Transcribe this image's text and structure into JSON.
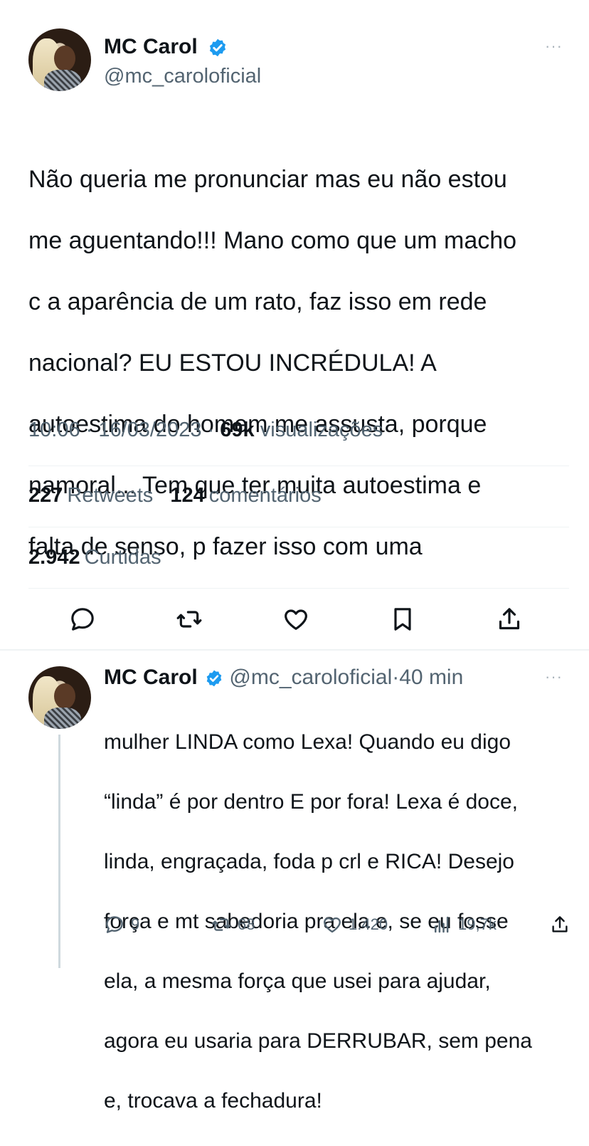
{
  "main_tweet": {
    "author_name": "MC Carol",
    "author_handle": "@mc_caroloficial",
    "text_lines": [
      "Não queria me pronunciar mas eu não estou",
      "me aguentando!!! Mano como que um macho",
      "c a aparência de um rato, faz isso em rede",
      "nacional? EU ESTOU INCRÉDULA! A",
      "autoestima do homem me assusta, porque",
      "namoral... Tem que ter muita autoestima e",
      "falta de senso, p fazer isso com uma"
    ],
    "time": "10:06",
    "date": "16/03/2023",
    "views_count": "69k",
    "views_label": "visualizações",
    "retweets_count": "227",
    "retweets_label": "Retweets",
    "comments_count": "124",
    "comments_label": "comentários",
    "likes_count": "2.942",
    "likes_label": "Curtidas",
    "more_label": "···"
  },
  "reply_tweet": {
    "author_name": "MC Carol",
    "author_handle": "@mc_caroloficial",
    "time_ago": "40 min",
    "text_lines": [
      "mulher LINDA como Lexa! Quando eu digo",
      "“linda” é por dentro E por fora! Lexa é doce,",
      "linda, engraçada, foda p crl e RICA! Desejo",
      "força e mt sabedoria pra ela e, se eu fosse",
      "ela, a mesma força que usei para ajudar,",
      "agora eu usaria para DERRUBAR, sem pena",
      "e, trocava a fechadura!"
    ],
    "replies": "9",
    "retweets": "68",
    "likes": "1.420",
    "views": "19,7k",
    "more_label": "···"
  },
  "icons": {
    "reply": "reply-icon",
    "retweet": "retweet-icon",
    "like": "heart-icon",
    "bookmark": "bookmark-icon",
    "share": "share-icon",
    "views": "views-icon",
    "verified": "verified-badge-icon"
  },
  "colors": {
    "verified": "#1d9bf0",
    "text": "#0f1419",
    "muted": "#536471"
  }
}
